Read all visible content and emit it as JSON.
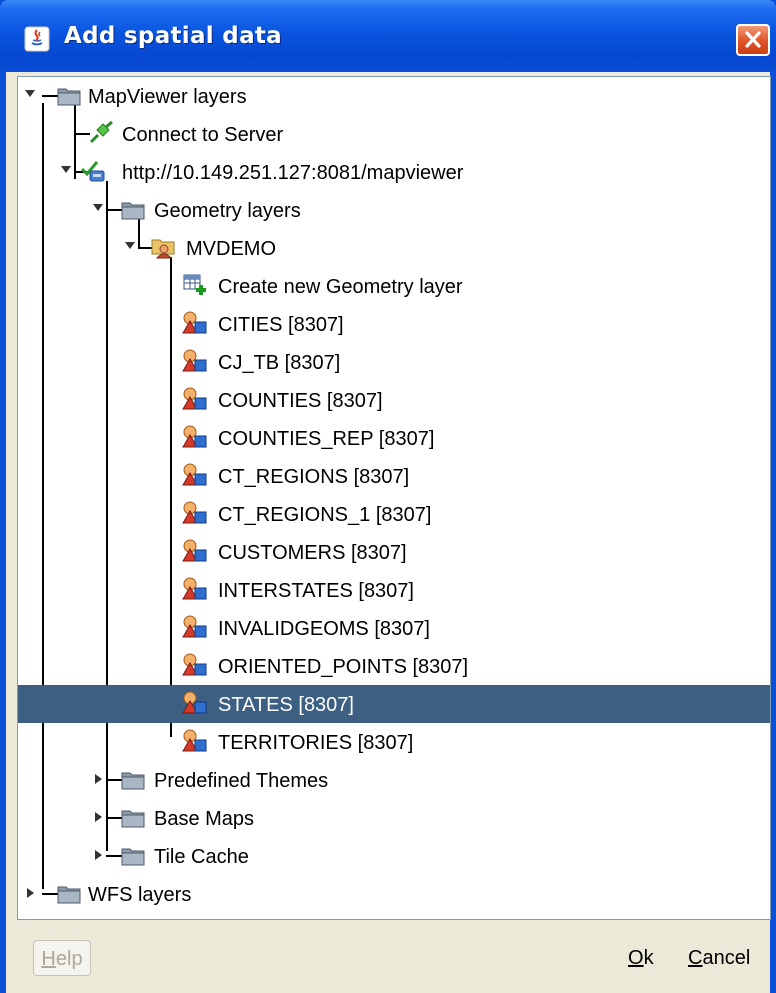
{
  "window": {
    "title": "Add spatial data"
  },
  "tree": {
    "root": {
      "label": "MapViewer layers",
      "expanded": true
    },
    "connect": {
      "label": "Connect to Server"
    },
    "server": {
      "label": "http://10.149.251.127:8081/mapviewer",
      "expanded": true
    },
    "geometry_layers": {
      "label": "Geometry layers",
      "expanded": true
    },
    "schema": {
      "label": "MVDEMO",
      "expanded": true
    },
    "create_new": {
      "label": "Create new Geometry layer"
    },
    "layers": [
      "CITIES [8307]",
      "CJ_TB [8307]",
      "COUNTIES [8307]",
      "COUNTIES_REP [8307]",
      "CT_REGIONS [8307]",
      "CT_REGIONS_1 [8307]",
      "CUSTOMERS [8307]",
      "INTERSTATES [8307]",
      "INVALIDGEOMS [8307]",
      "ORIENTED_POINTS [8307]",
      "STATES [8307]",
      "TERRITORIES [8307]"
    ],
    "selected_layer": "STATES [8307]",
    "predefined_themes": {
      "label": "Predefined Themes",
      "expanded": false
    },
    "base_maps": {
      "label": "Base Maps",
      "expanded": false
    },
    "tile_cache": {
      "label": "Tile Cache",
      "expanded": false
    },
    "wfs_layers": {
      "label": "WFS layers",
      "expanded": false
    }
  },
  "buttons": {
    "help": {
      "mnemonic": "H",
      "rest": "elp",
      "enabled": false
    },
    "ok": {
      "mnemonic": "O",
      "rest": "k"
    },
    "cancel": {
      "mnemonic": "C",
      "rest": "ancel"
    }
  },
  "colors": {
    "title_bar": "#0a4fd6",
    "selection": "#3c5f82",
    "dialog_bg": "#ece9d8",
    "close_button": "#e0582e"
  }
}
